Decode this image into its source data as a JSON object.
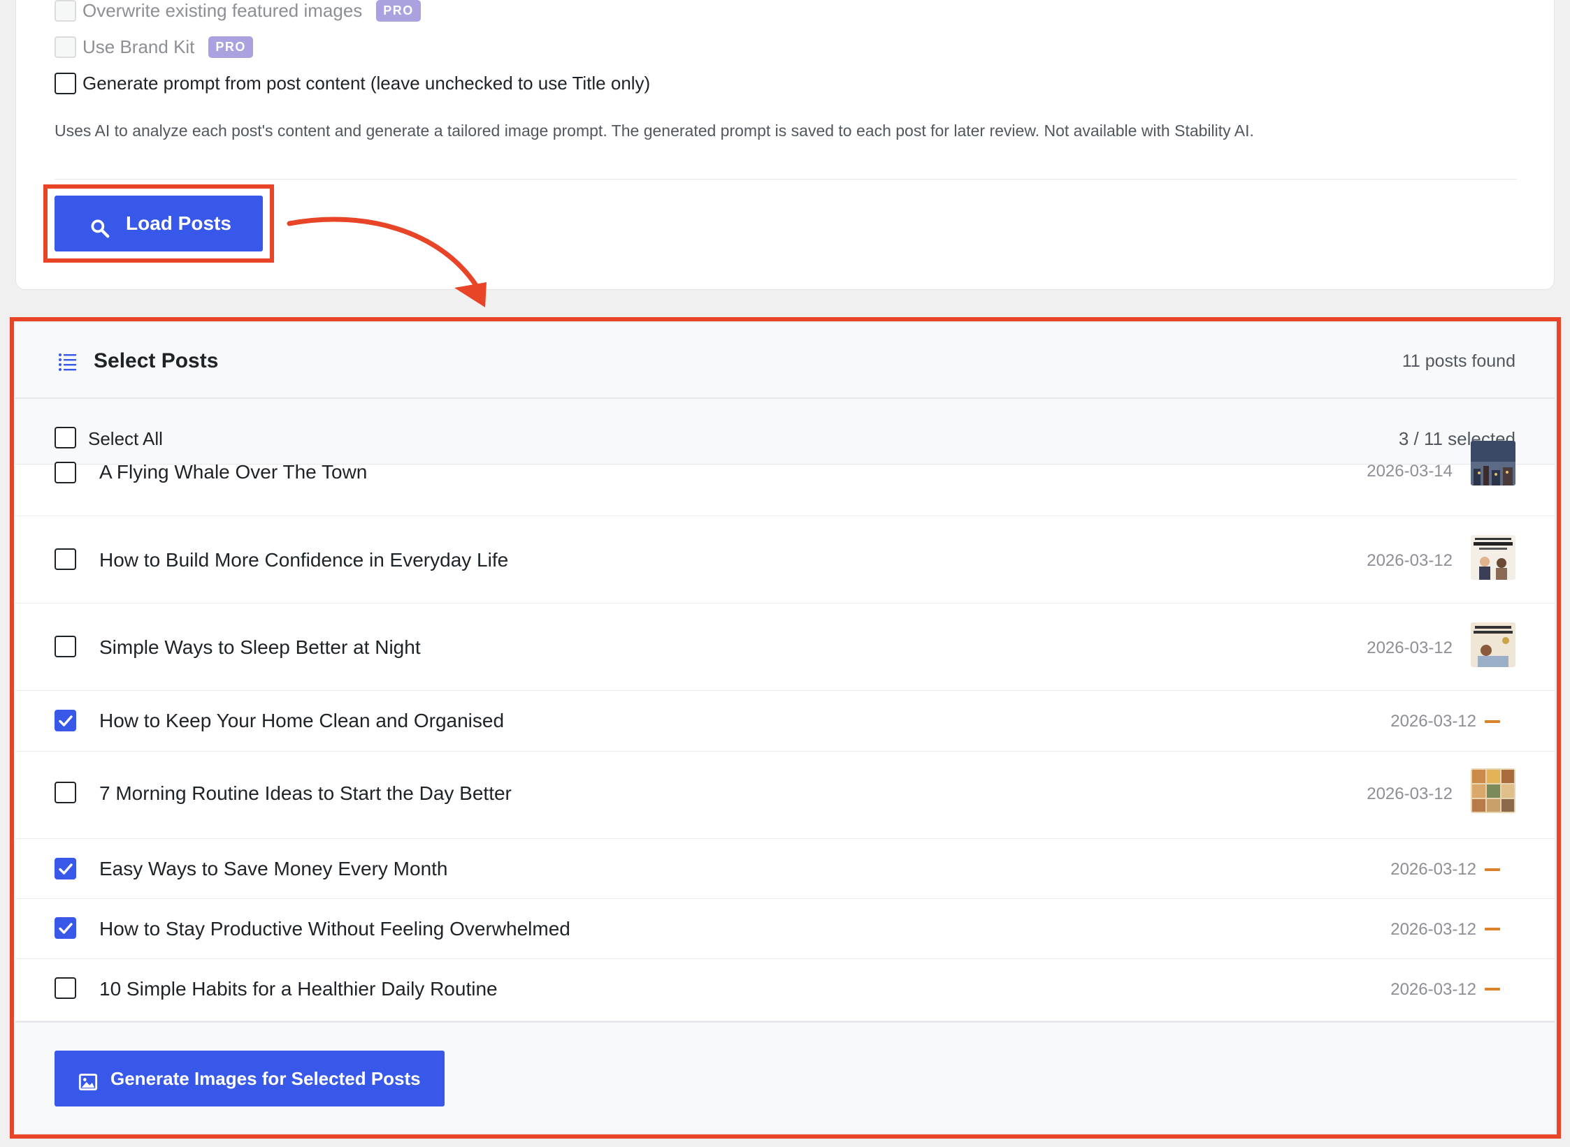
{
  "settings": {
    "options": [
      {
        "label": "Overwrite existing featured images",
        "badge": "PRO",
        "disabled": true,
        "checked": false
      },
      {
        "label": "Use Brand Kit",
        "badge": "PRO",
        "disabled": true,
        "checked": false
      },
      {
        "label": "Generate prompt from post content (leave unchecked to use Title only)",
        "disabled": false,
        "checked": false
      }
    ],
    "help_text": "Uses AI to analyze each post's content and generate a tailored image prompt. The generated prompt is saved to each post for later review. Not available with Stability AI.",
    "load_button_label": "Load Posts"
  },
  "posts_panel": {
    "title": "Select Posts",
    "posts_found": "11 posts found",
    "select_all_label": "Select All",
    "selected_count": "3 / 11 selected",
    "posts": [
      {
        "title": "A Flying Whale Over The Town",
        "date": "2026-03-14",
        "checked": false,
        "status": "thumbnail",
        "thumb_icon": "whale-town-thumbnail"
      },
      {
        "title": "How to Build More Confidence in Everyday Life",
        "date": "2026-03-12",
        "checked": false,
        "status": "thumbnail",
        "thumb_icon": "confidence-thumbnail"
      },
      {
        "title": "Simple Ways to Sleep Better at Night",
        "date": "2026-03-12",
        "checked": false,
        "status": "thumbnail",
        "thumb_icon": "sleep-thumbnail"
      },
      {
        "title": "How to Keep Your Home Clean and Organised",
        "date": "2026-03-12",
        "checked": true,
        "status": "no-image",
        "thumb_icon": "dash-icon"
      },
      {
        "title": "7 Morning Routine Ideas to Start the Day Better",
        "date": "2026-03-12",
        "checked": false,
        "status": "thumbnail",
        "thumb_icon": "morning-routine-thumbnail"
      },
      {
        "title": "Easy Ways to Save Money Every Month",
        "date": "2026-03-12",
        "checked": true,
        "status": "no-image",
        "thumb_icon": "dash-icon"
      },
      {
        "title": "How to Stay Productive Without Feeling Overwhelmed",
        "date": "2026-03-12",
        "checked": true,
        "status": "no-image",
        "thumb_icon": "dash-icon"
      },
      {
        "title": "10 Simple Habits for a Healthier Daily Routine",
        "date": "2026-03-12",
        "checked": false,
        "status": "no-image",
        "thumb_icon": "dash-icon"
      }
    ],
    "generate_button_label": "Generate Images for Selected Posts"
  },
  "colors": {
    "primary": "#3858e9",
    "annotation": "#e84427",
    "pro_badge": "#a9a2df",
    "no_image_dash": "#d9822b"
  }
}
